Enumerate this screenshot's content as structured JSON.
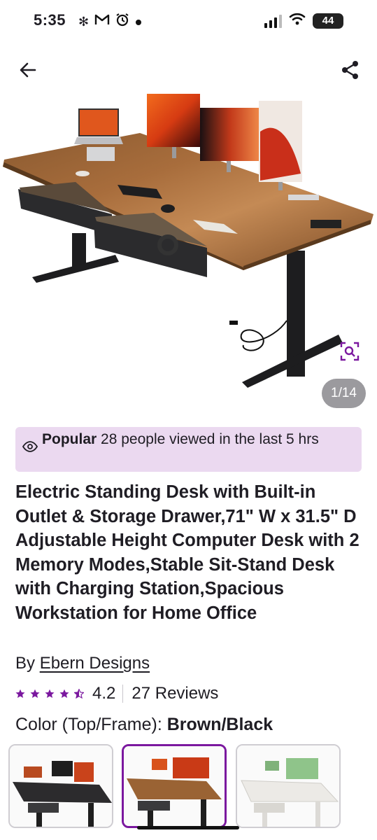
{
  "status_bar": {
    "time": "5:35",
    "left_icons": [
      "fan-icon",
      "gmail-icon",
      "alarm-icon",
      "dot-icon"
    ],
    "battery": "44"
  },
  "header": {
    "back_icon": "arrow-left-icon",
    "share_icon": "share-icon"
  },
  "gallery": {
    "counter": "1/14",
    "zoom_icon": "zoom-search-icon"
  },
  "popular": {
    "icon": "eye-icon",
    "label": "Popular",
    "text": "28 people viewed in the last 5 hrs",
    "color": "#ebd9f0"
  },
  "product": {
    "title": "Electric Standing Desk with Built-in Outlet & Storage Drawer,71\" W x 31.5\" D Adjustable Height Computer Desk with 2 Memory Modes,Stable Sit-Stand Desk with Charging Station,Spacious Workstation for Home Office",
    "brand_prefix": "By",
    "brand": "Ebern Designs",
    "rating": "4.2",
    "rating_stars": 4.2,
    "reviews": "27 Reviews",
    "star_color": "#7b189f"
  },
  "color_option": {
    "label": "Color (Top/Frame):",
    "selected": "Brown/Black",
    "swatches": [
      {
        "name": "black-black",
        "selected": false
      },
      {
        "name": "brown-black",
        "selected": true
      },
      {
        "name": "white-white",
        "selected": false
      }
    ],
    "accent_color": "#7b189f"
  }
}
